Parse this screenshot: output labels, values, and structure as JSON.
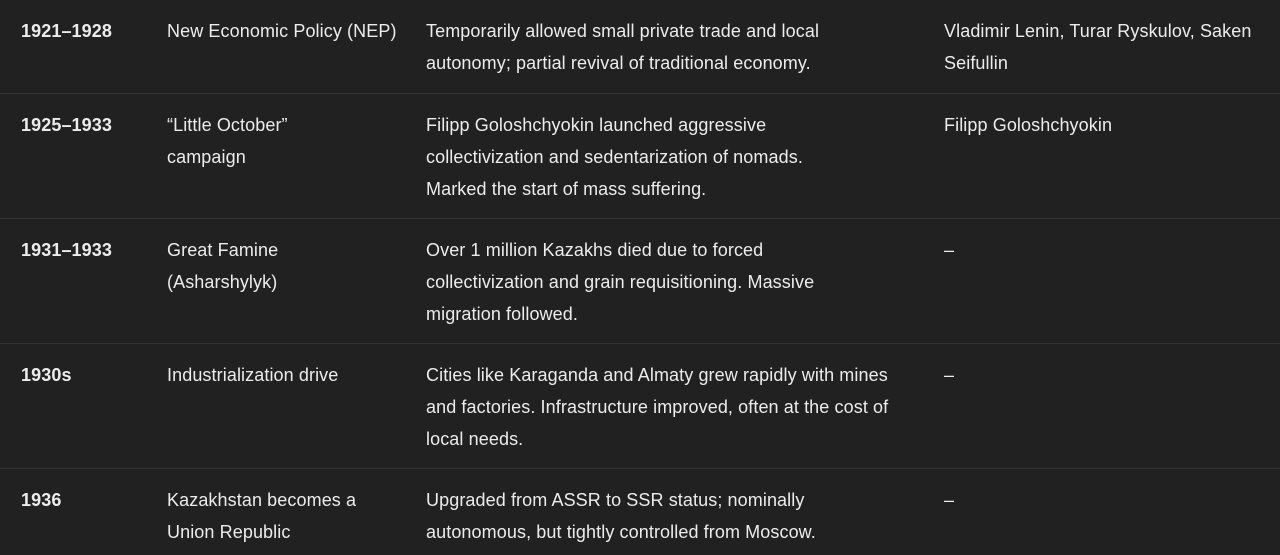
{
  "table": {
    "rows": [
      {
        "date": "1921–1928",
        "event": "New Economic Policy (NEP)",
        "description": "Temporarily allowed small private trade and local autonomy; partial revival of traditional economy.",
        "figures": "Vladimir Lenin, Turar Ryskulov, Saken Seifullin"
      },
      {
        "date": "1925–1933",
        "event": "“Little October” campaign",
        "description": "Filipp Goloshchyokin launched aggressive collectivization and sedentarization of nomads. Marked the start of mass suffering.",
        "figures": "Filipp Goloshchyokin"
      },
      {
        "date": "1931–1933",
        "event": "Great Famine (Asharshylyk)",
        "description": "Over 1 million Kazakhs died due to forced collectivization and grain requisitioning. Massive migration followed.",
        "figures": "–"
      },
      {
        "date": "1930s",
        "event": "Industrialization drive",
        "description": "Cities like Karaganda and Almaty grew rapidly with mines and factories. Infrastructure improved, often at the cost of local needs.",
        "figures": "–"
      },
      {
        "date": "1936",
        "event": "Kazakhstan becomes a Union Republic",
        "description": "Upgraded from ASSR to SSR status; nominally autonomous, but tightly controlled from Moscow.",
        "figures": "–"
      }
    ]
  }
}
